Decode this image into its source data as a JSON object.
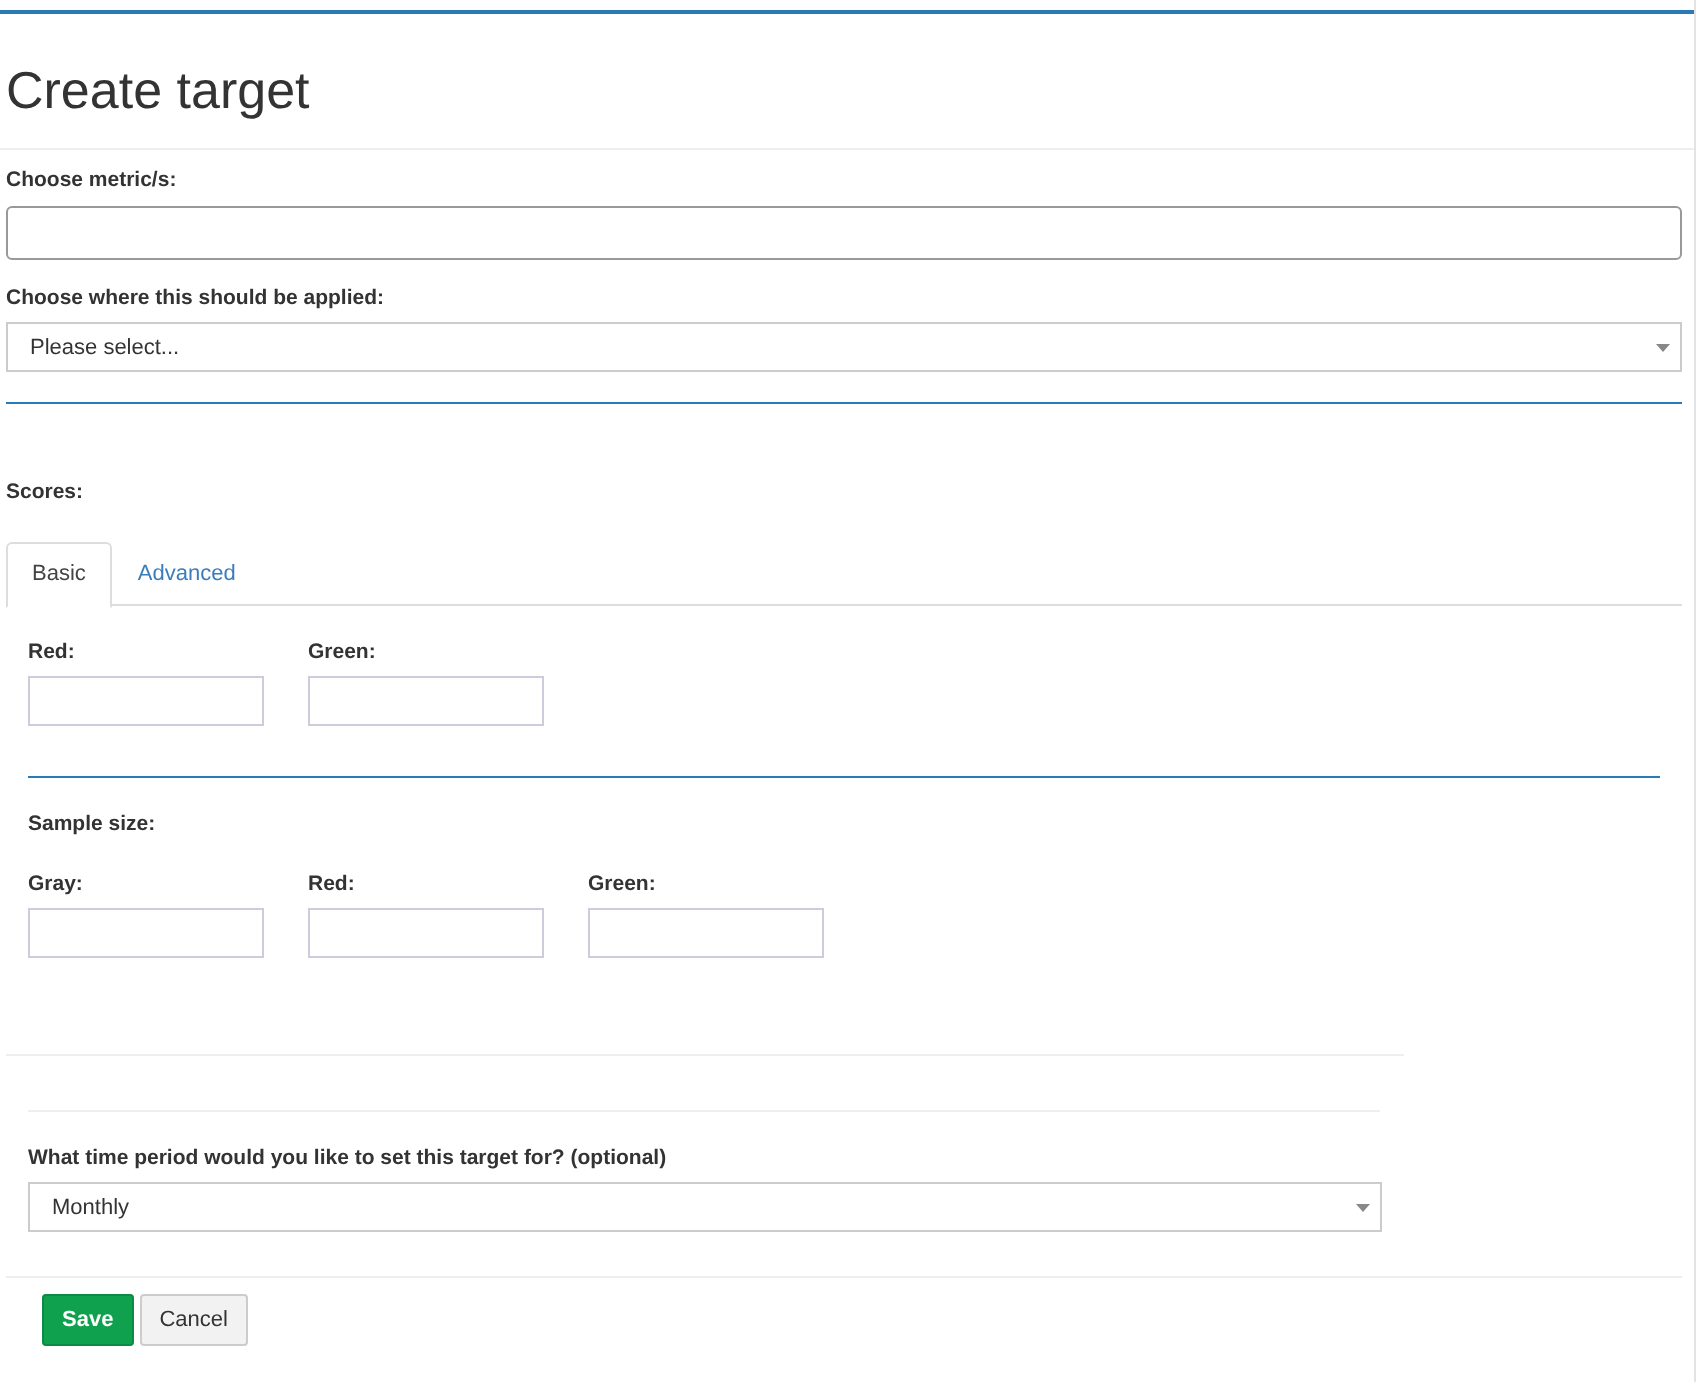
{
  "title": "Create target",
  "metric": {
    "label": "Choose metric/s:"
  },
  "applied": {
    "label": "Choose where this should be applied:",
    "value": "Please select..."
  },
  "scores": {
    "label": "Scores:",
    "tabs": [
      {
        "label": "Basic",
        "selected": true
      },
      {
        "label": "Advanced",
        "selected": false
      }
    ],
    "fields": [
      {
        "label": "Red:"
      },
      {
        "label": "Green:"
      }
    ],
    "sample_size": {
      "label": "Sample size:",
      "fields": [
        {
          "label": "Gray:"
        },
        {
          "label": "Red:"
        },
        {
          "label": "Green:"
        }
      ]
    }
  },
  "time_period": {
    "label": "What time period would you like to set this target for? (optional)",
    "value": "Monthly"
  },
  "buttons": [
    {
      "label": "Save",
      "kind": "primary"
    },
    {
      "label": "Cancel",
      "kind": "default"
    }
  ]
}
